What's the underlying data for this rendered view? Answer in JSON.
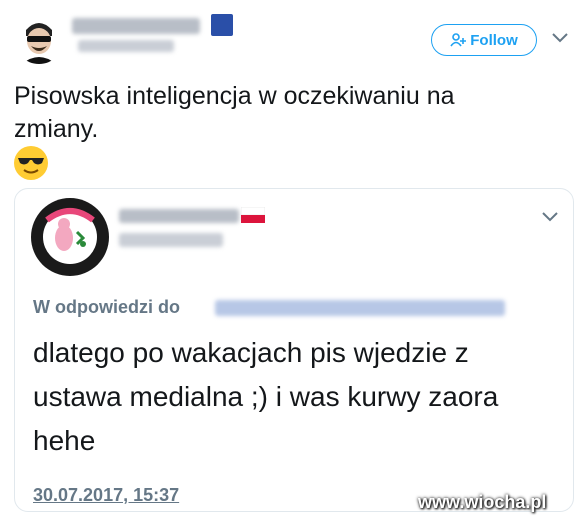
{
  "tweet": {
    "follow_label": "Follow",
    "text": "Pisowska inteligencja w oczekiwaniu na zmiany.",
    "emoji": "😎"
  },
  "quoted": {
    "reply_prefix": "W odpowiedzi do",
    "text": "dlatego po wakacjach pis wjedzie z ustawa medialna ;) i was kurwy zaora hehe",
    "date": "30.07.2017, 15:37"
  },
  "watermark": "www.wiocha.pl",
  "colors": {
    "accent": "#1da1f2",
    "muted": "#657786",
    "border": "#e1e8ed"
  }
}
